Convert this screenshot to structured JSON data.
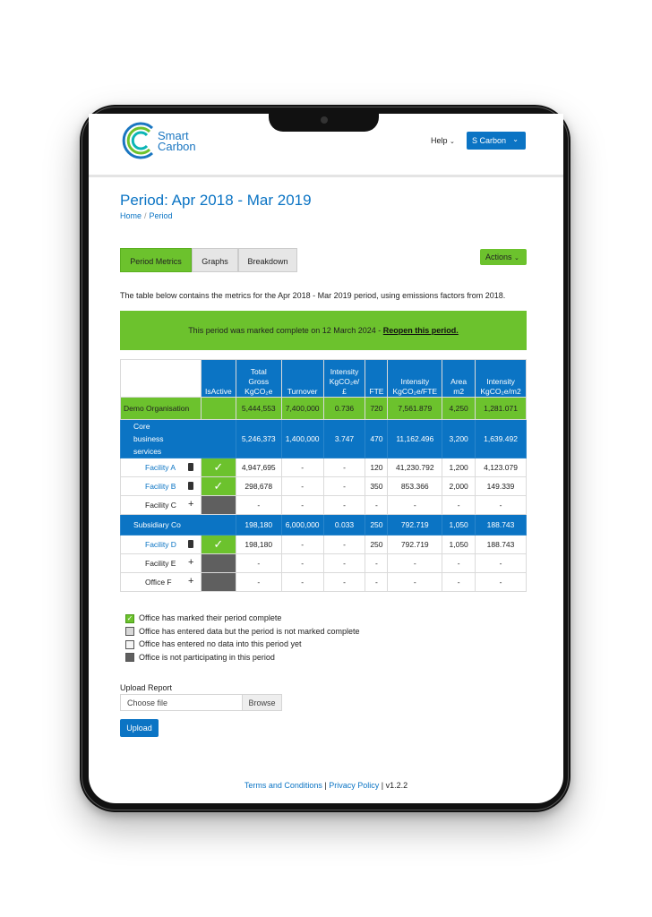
{
  "brand": {
    "line1": "Smart",
    "line2": "Carbon",
    "colors": [
      "#1a76c1",
      "#6cc22d",
      "#0bb5b5"
    ]
  },
  "nav": {
    "help": "Help",
    "user": "S Carbon"
  },
  "page": {
    "title": "Period: Apr 2018 - Mar 2019",
    "breadcrumb": [
      "Home",
      "Period"
    ]
  },
  "tabs": [
    "Period Metrics",
    "Graphs",
    "Breakdown"
  ],
  "actions_label": "Actions",
  "intro": "The table below contains the metrics for the Apr 2018 - Mar 2019 period, using emissions factors from 2018.",
  "banner": {
    "text": "This period was marked complete on 12 March 2024 - ",
    "link": "Reopen this period."
  },
  "table": {
    "headers": [
      {
        "lines": [
          "IsActive"
        ]
      },
      {
        "lines": [
          "Total",
          "Gross",
          "KgCO₂e"
        ]
      },
      {
        "lines": [
          "Turnover"
        ]
      },
      {
        "lines": [
          "Intensity",
          "KgCO₂e/",
          "£"
        ]
      },
      {
        "lines": [
          "FTE"
        ]
      },
      {
        "lines": [
          "Intensity",
          "KgCO₂e/FTE"
        ]
      },
      {
        "lines": [
          "Area",
          "m2"
        ]
      },
      {
        "lines": [
          "Intensity",
          "KgCO₂e/m2"
        ]
      }
    ],
    "rows": [
      {
        "type": "org",
        "name": "Demo Organisation",
        "values": [
          "5,444,553",
          "7,400,000",
          "0.736",
          "720",
          "7,561.879",
          "4,250",
          "1,281.071"
        ]
      },
      {
        "type": "group",
        "name": "Core business services",
        "values": [
          "5,246,373",
          "1,400,000",
          "3.747",
          "470",
          "11,162.496",
          "3,200",
          "1,639.492"
        ]
      },
      {
        "type": "facility",
        "name": "Facility A",
        "icon": "trash-icon",
        "status": "complete",
        "values": [
          "4,947,695",
          "-",
          "-",
          "120",
          "41,230.792",
          "1,200",
          "4,123.079"
        ]
      },
      {
        "type": "facility",
        "name": "Facility B",
        "icon": "trash-icon",
        "status": "complete",
        "values": [
          "298,678",
          "-",
          "-",
          "350",
          "853.366",
          "2,000",
          "149.339"
        ]
      },
      {
        "type": "facility",
        "name": "Facility C",
        "icon": "plus-icon",
        "status": "not-participating",
        "values": [
          "-",
          "-",
          "-",
          "-",
          "-",
          "-",
          "-"
        ]
      },
      {
        "type": "group",
        "name": "Subsidiary Co",
        "values": [
          "198,180",
          "6,000,000",
          "0.033",
          "250",
          "792.719",
          "1,050",
          "188.743"
        ]
      },
      {
        "type": "facility",
        "name": "Facility D",
        "icon": "trash-icon",
        "status": "complete",
        "values": [
          "198,180",
          "-",
          "-",
          "250",
          "792.719",
          "1,050",
          "188.743"
        ]
      },
      {
        "type": "facility",
        "name": "Facility E",
        "icon": "plus-icon",
        "status": "not-participating",
        "values": [
          "-",
          "-",
          "-",
          "-",
          "-",
          "-",
          "-"
        ]
      },
      {
        "type": "facility",
        "name": "Office F",
        "icon": "plus-icon",
        "status": "not-participating",
        "values": [
          "-",
          "-",
          "-",
          "-",
          "-",
          "-",
          "-"
        ]
      }
    ]
  },
  "legend": [
    {
      "kind": "complete",
      "label": "Office has marked their period complete"
    },
    {
      "kind": "partial",
      "label": "Office has entered data but the period is not marked complete"
    },
    {
      "kind": "empty",
      "label": "Office has entered no data into this period yet"
    },
    {
      "kind": "not-participating",
      "label": "Office is not participating in this period"
    }
  ],
  "upload": {
    "label": "Upload Report",
    "placeholder": "Choose file",
    "browse": "Browse",
    "button": "Upload"
  },
  "footer": {
    "terms": "Terms and Conditions",
    "sep": " | ",
    "privacy": "Privacy Policy",
    "version": " | v1.2.2"
  }
}
